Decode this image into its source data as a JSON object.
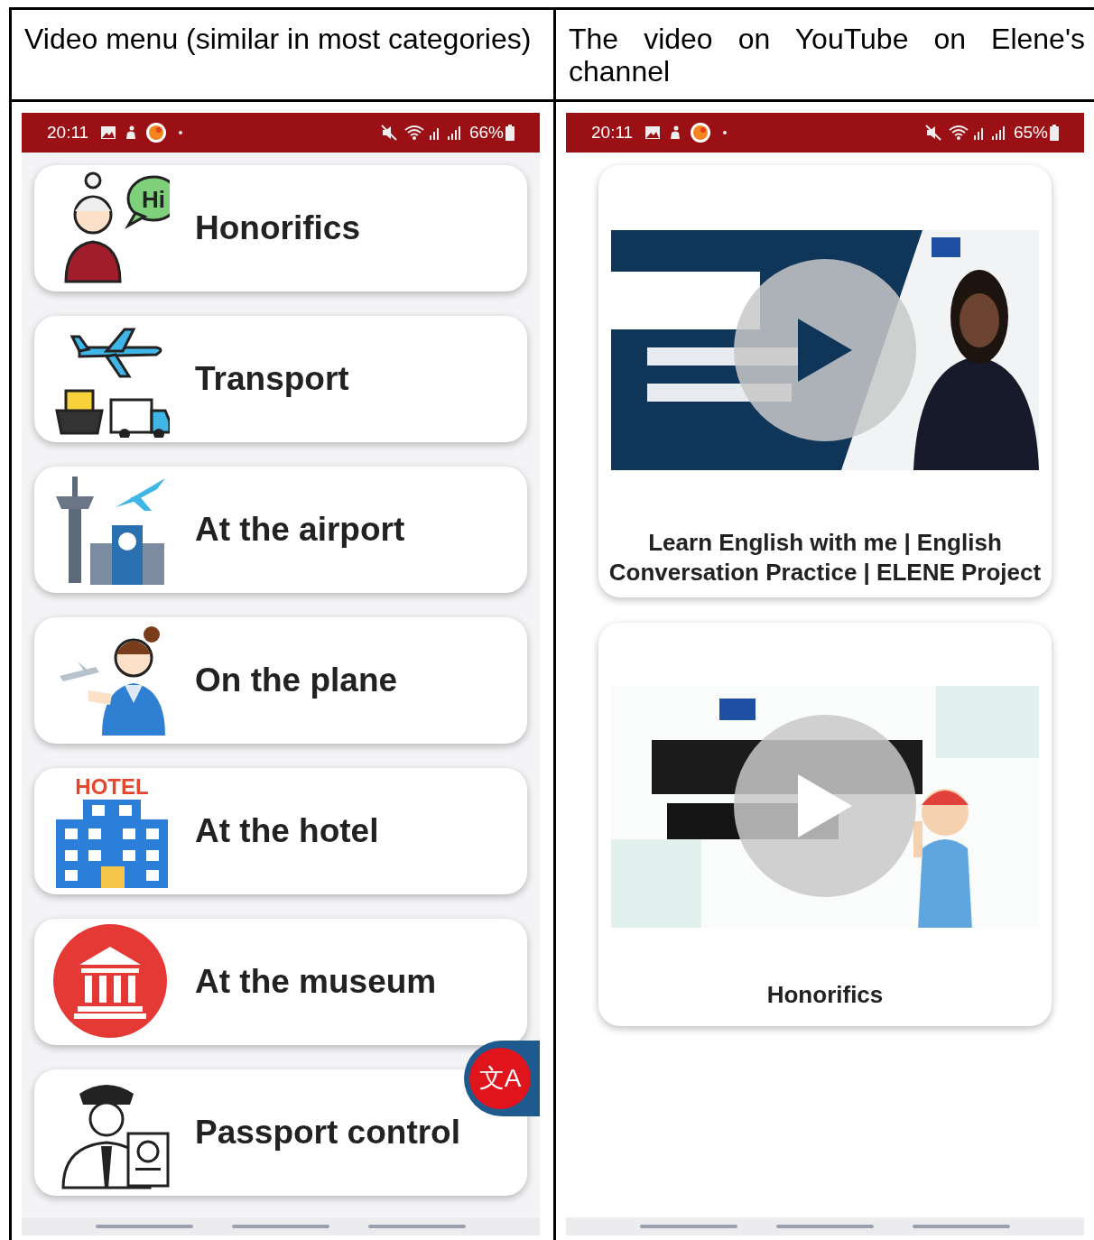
{
  "columns": [
    {
      "heading": "Video menu (similar in most categories)"
    },
    {
      "heading": "The video on YouTube on Elene's channel"
    }
  ],
  "left_phone": {
    "status_bar": {
      "time": "20:11",
      "battery": "66%"
    },
    "menu": [
      {
        "label": "Honorifics",
        "icon_label": "Hi"
      },
      {
        "label": "Transport"
      },
      {
        "label": "At the airport"
      },
      {
        "label": "On the plane"
      },
      {
        "label": "At the hotel",
        "icon_label": "HOTEL"
      },
      {
        "label": "At the museum"
      },
      {
        "label": "Passport control"
      }
    ],
    "translate_button": {
      "glyph": "文A"
    }
  },
  "right_phone": {
    "status_bar": {
      "time": "20:11",
      "battery": "65%"
    },
    "videos": [
      {
        "title": "Learn English with me | English Conversation Practice | ELENE Project",
        "kind": "picture"
      },
      {
        "title": "Honorifics",
        "kind": "picture"
      }
    ]
  }
}
